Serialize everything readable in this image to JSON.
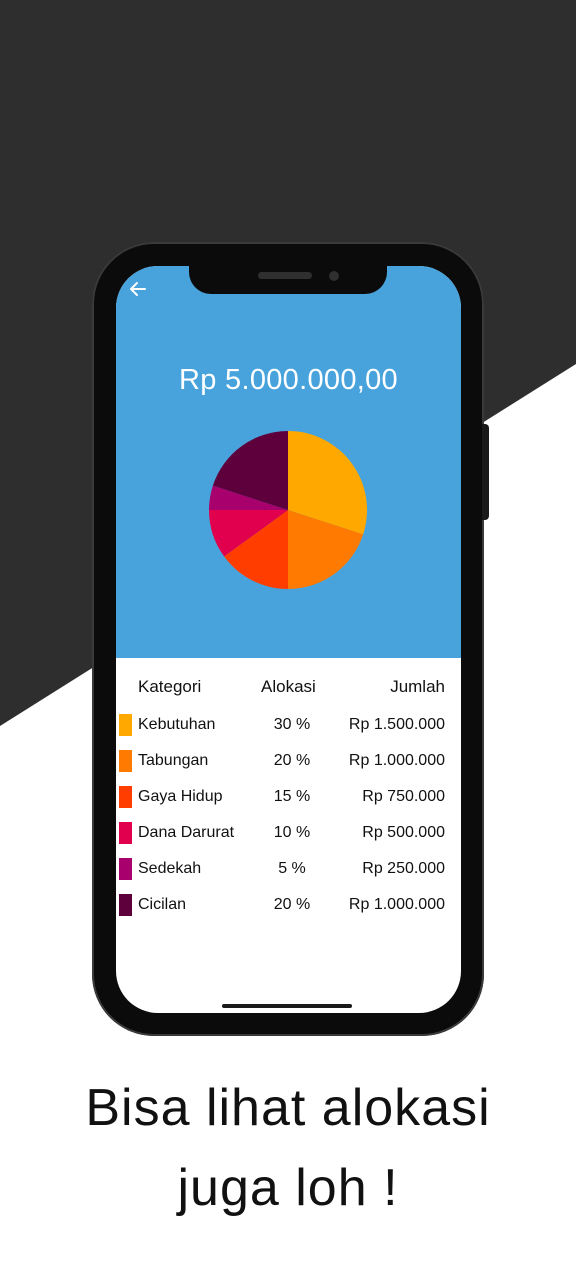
{
  "app": {
    "total_amount": "Rp 5.000.000,00",
    "back_icon": "arrow-left-icon"
  },
  "table": {
    "headers": {
      "category": "Kategori",
      "allocation": "Alokasi",
      "amount": "Jumlah"
    },
    "rows": [
      {
        "category": "Kebutuhan",
        "allocation": "30 %",
        "amount": "Rp 1.500.000",
        "color": "#ffa800"
      },
      {
        "category": "Tabungan",
        "allocation": "20 %",
        "amount": "Rp 1.000.000",
        "color": "#ff7a00"
      },
      {
        "category": "Gaya Hidup",
        "allocation": "15 %",
        "amount": "Rp 750.000",
        "color": "#ff3d00"
      },
      {
        "category": "Dana Darurat",
        "allocation": "10 %",
        "amount": "Rp 500.000",
        "color": "#e0004d"
      },
      {
        "category": "Sedekah",
        "allocation": "5 %",
        "amount": "Rp 250.000",
        "color": "#a8006c"
      },
      {
        "category": "Cicilan",
        "allocation": "20 %",
        "amount": "Rp 1.000.000",
        "color": "#5e003c"
      }
    ]
  },
  "chart_data": {
    "type": "pie",
    "categories": [
      "Kebutuhan",
      "Tabungan",
      "Gaya Hidup",
      "Dana Darurat",
      "Sedekah",
      "Cicilan"
    ],
    "values": [
      30,
      20,
      15,
      10,
      5,
      20
    ],
    "colors": [
      "#ffa800",
      "#ff7a00",
      "#ff3d00",
      "#e0004d",
      "#a8006c",
      "#5e003c"
    ]
  },
  "caption": {
    "line1": "Bisa lihat alokasi",
    "line2": "juga loh !"
  },
  "colors": {
    "header_blue": "#48a3dc",
    "background_dark": "#2e2e2e"
  }
}
